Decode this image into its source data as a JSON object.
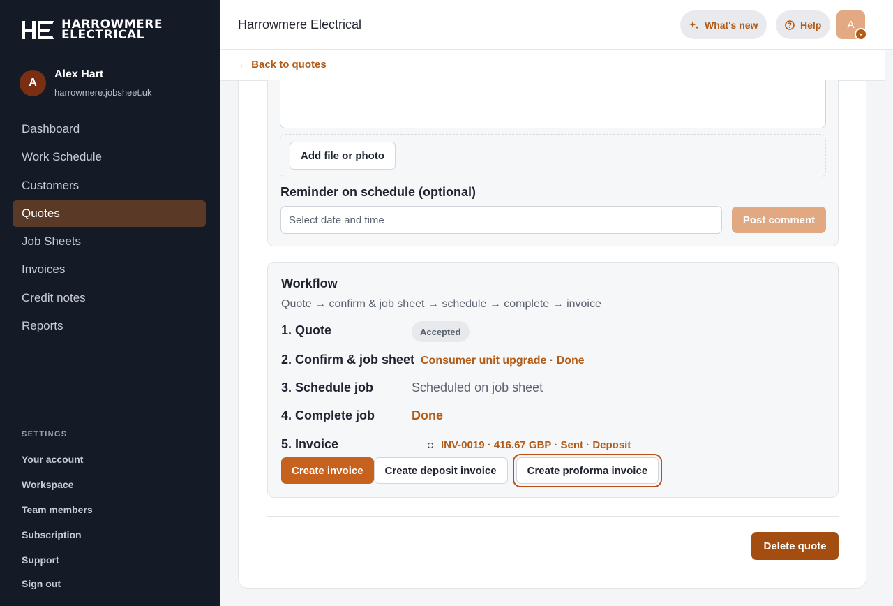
{
  "brand": {
    "logo_mark": "HE",
    "logo_line1": "HARROWMERE",
    "logo_line2": "ELECTRICAL"
  },
  "user": {
    "initial": "A",
    "name": "Alex Hart",
    "domain": "harrowmere.jobsheet.uk"
  },
  "nav": {
    "items": [
      {
        "label": "Dashboard",
        "active": false
      },
      {
        "label": "Work Schedule",
        "active": false
      },
      {
        "label": "Customers",
        "active": false
      },
      {
        "label": "Quotes",
        "active": true
      },
      {
        "label": "Job Sheets",
        "active": false
      },
      {
        "label": "Invoices",
        "active": false
      },
      {
        "label": "Credit notes",
        "active": false
      },
      {
        "label": "Reports",
        "active": false
      }
    ]
  },
  "settings": {
    "heading": "SETTINGS",
    "items": [
      "Your account",
      "Workspace",
      "Team members",
      "Subscription",
      "Support"
    ],
    "sign_out": "Sign out"
  },
  "header": {
    "title": "Harrowmere Electrical",
    "whats_new": "What's new",
    "help": "Help",
    "avatar_initial": "A"
  },
  "back_link": "← Back to quotes",
  "comment": {
    "add_file": "Add file or photo",
    "reminder_label": "Reminder on schedule (optional)",
    "date_placeholder": "Select date and time",
    "post_button": "Post comment"
  },
  "workflow": {
    "title": "Workflow",
    "subtitle": "Quote → confirm & job sheet → schedule → complete → invoice",
    "steps": [
      {
        "label": "1. Quote",
        "status": "Accepted"
      },
      {
        "label": "2. Confirm & job sheet",
        "status": "Consumer unit upgrade · Done"
      },
      {
        "label": "3. Schedule job",
        "status": "Scheduled on job sheet"
      },
      {
        "label": "4. Complete job",
        "status": "Done"
      },
      {
        "label": "5. Invoice",
        "status": "INV-0019 · 416.67 GBP · Sent · Deposit"
      }
    ],
    "buttons": {
      "create_invoice": "Create invoice",
      "create_deposit": "Create deposit invoice",
      "create_proforma": "Create proforma invoice"
    }
  },
  "delete_button": "Delete quote",
  "colors": {
    "accent": "#b35a14",
    "sidebar_bg": "#141a26",
    "active_nav": "#5a3a26",
    "primary_btn": "#c7611e",
    "delete_btn": "#a44d10"
  }
}
